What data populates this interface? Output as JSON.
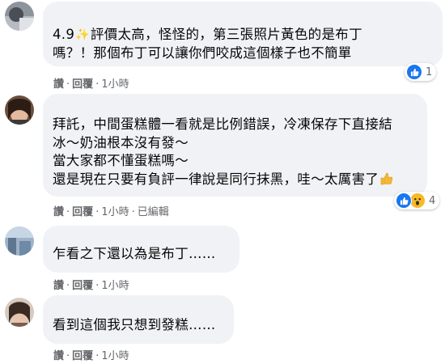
{
  "comments": [
    {
      "line1_rating": "4.9",
      "line1_rest": "評價太高，怪怪的，第三張照片黃色的是布丁",
      "line2": "嗎？！那個布丁可以讓你們咬成這個樣子也不簡單",
      "actions": {
        "like": "讚",
        "reply": "回覆",
        "time": "1小時"
      },
      "reaction_icon": "like-icon",
      "reaction_count": "1"
    },
    {
      "lines": [
        "拜託，中間蛋糕體一看就是比例錯誤，冷凍保存下直接結",
        "冰～奶油根本沒有發～",
        "當大家都不懂蛋糕嗎～",
        "還是現在只要有負評一律說是同行抹黑，哇～太厲害了"
      ],
      "actions": {
        "like": "讚",
        "reply": "回覆",
        "time": "1小時",
        "edited": "已編輯"
      },
      "reaction_icons": [
        "like-icon",
        "wow-icon"
      ],
      "reaction_count": "4"
    },
    {
      "text": "乍看之下還以為是布丁……",
      "actions": {
        "like": "讚",
        "reply": "回覆",
        "time": "1小時"
      }
    },
    {
      "text": "看到這個我只想到發糕……",
      "actions": {
        "like": "讚",
        "reply": "回覆",
        "time": "1小時"
      }
    }
  ],
  "colors": {
    "bubble": "#f0f2f5",
    "text": "#050505",
    "meta": "#65676b",
    "like_blue": "#1877f2",
    "wow_yellow": "#f7b928"
  }
}
